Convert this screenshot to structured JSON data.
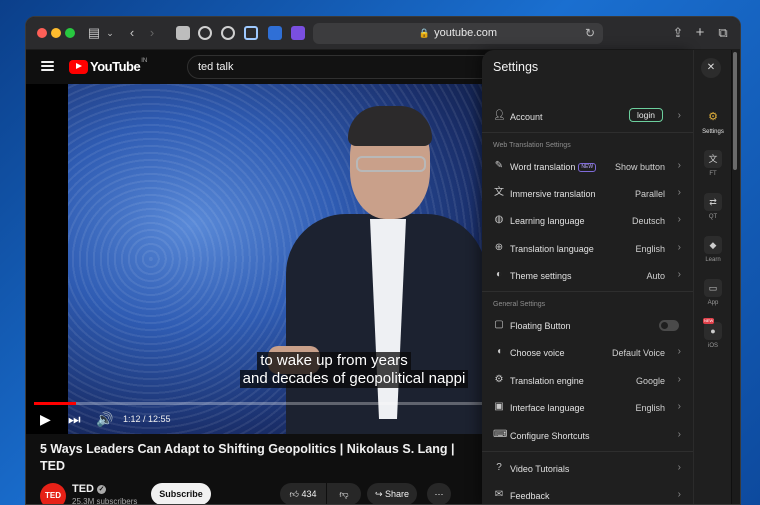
{
  "browser": {
    "url": "youtube.com"
  },
  "youtube": {
    "logo_text": "YouTube",
    "region": "IN",
    "search_value": "ted talk",
    "subtitle_line1": "to wake up from years",
    "subtitle_line2": "and decades of geopolitical nappi",
    "time": "1:12 / 12:55",
    "progress_fraction": 0.094,
    "title": "5 Ways Leaders Can Adapt to Shifting Geopolitics | Nikolaus S. Lang | TED",
    "channel": "TED",
    "channel_avatar_text": "TED",
    "subscribers": "25.3M subscribers",
    "subscribe_label": "Subscribe",
    "likes": "434",
    "share_label": "Share"
  },
  "settings": {
    "title": "Settings",
    "account": {
      "label": "Account",
      "button": "login"
    },
    "web_translation_header": "Web Translation Settings",
    "web_rows": [
      {
        "label": "Word translation",
        "badge": "NEW",
        "value": "Show button"
      },
      {
        "label": "Immersive translation",
        "value": "Parallel"
      },
      {
        "label": "Learning language",
        "value": "Deutsch"
      },
      {
        "label": "Translation language",
        "value": "English"
      },
      {
        "label": "Theme settings",
        "value": "Auto"
      }
    ],
    "general_header": "General Settings",
    "general_rows": [
      {
        "label": "Floating Button",
        "toggle": false
      },
      {
        "label": "Choose voice",
        "value": "Default Voice"
      },
      {
        "label": "Translation engine",
        "value": "Google"
      },
      {
        "label": "Interface language",
        "value": "English"
      },
      {
        "label": "Configure Shortcuts"
      }
    ],
    "support_rows": [
      {
        "label": "Video Tutorials"
      },
      {
        "label": "Feedback"
      }
    ]
  },
  "rail": {
    "items": [
      {
        "label": "Settings",
        "icon": "gear-icon",
        "active": true
      },
      {
        "label": "FT",
        "icon": "translate-icon"
      },
      {
        "label": "QT",
        "icon": "quick-translate-icon"
      },
      {
        "label": "Learn",
        "icon": "graduation-cap-icon"
      },
      {
        "label": "App",
        "icon": "app-icon"
      },
      {
        "label": "iOS",
        "icon": "apple-icon",
        "badge": "NEW"
      }
    ]
  }
}
